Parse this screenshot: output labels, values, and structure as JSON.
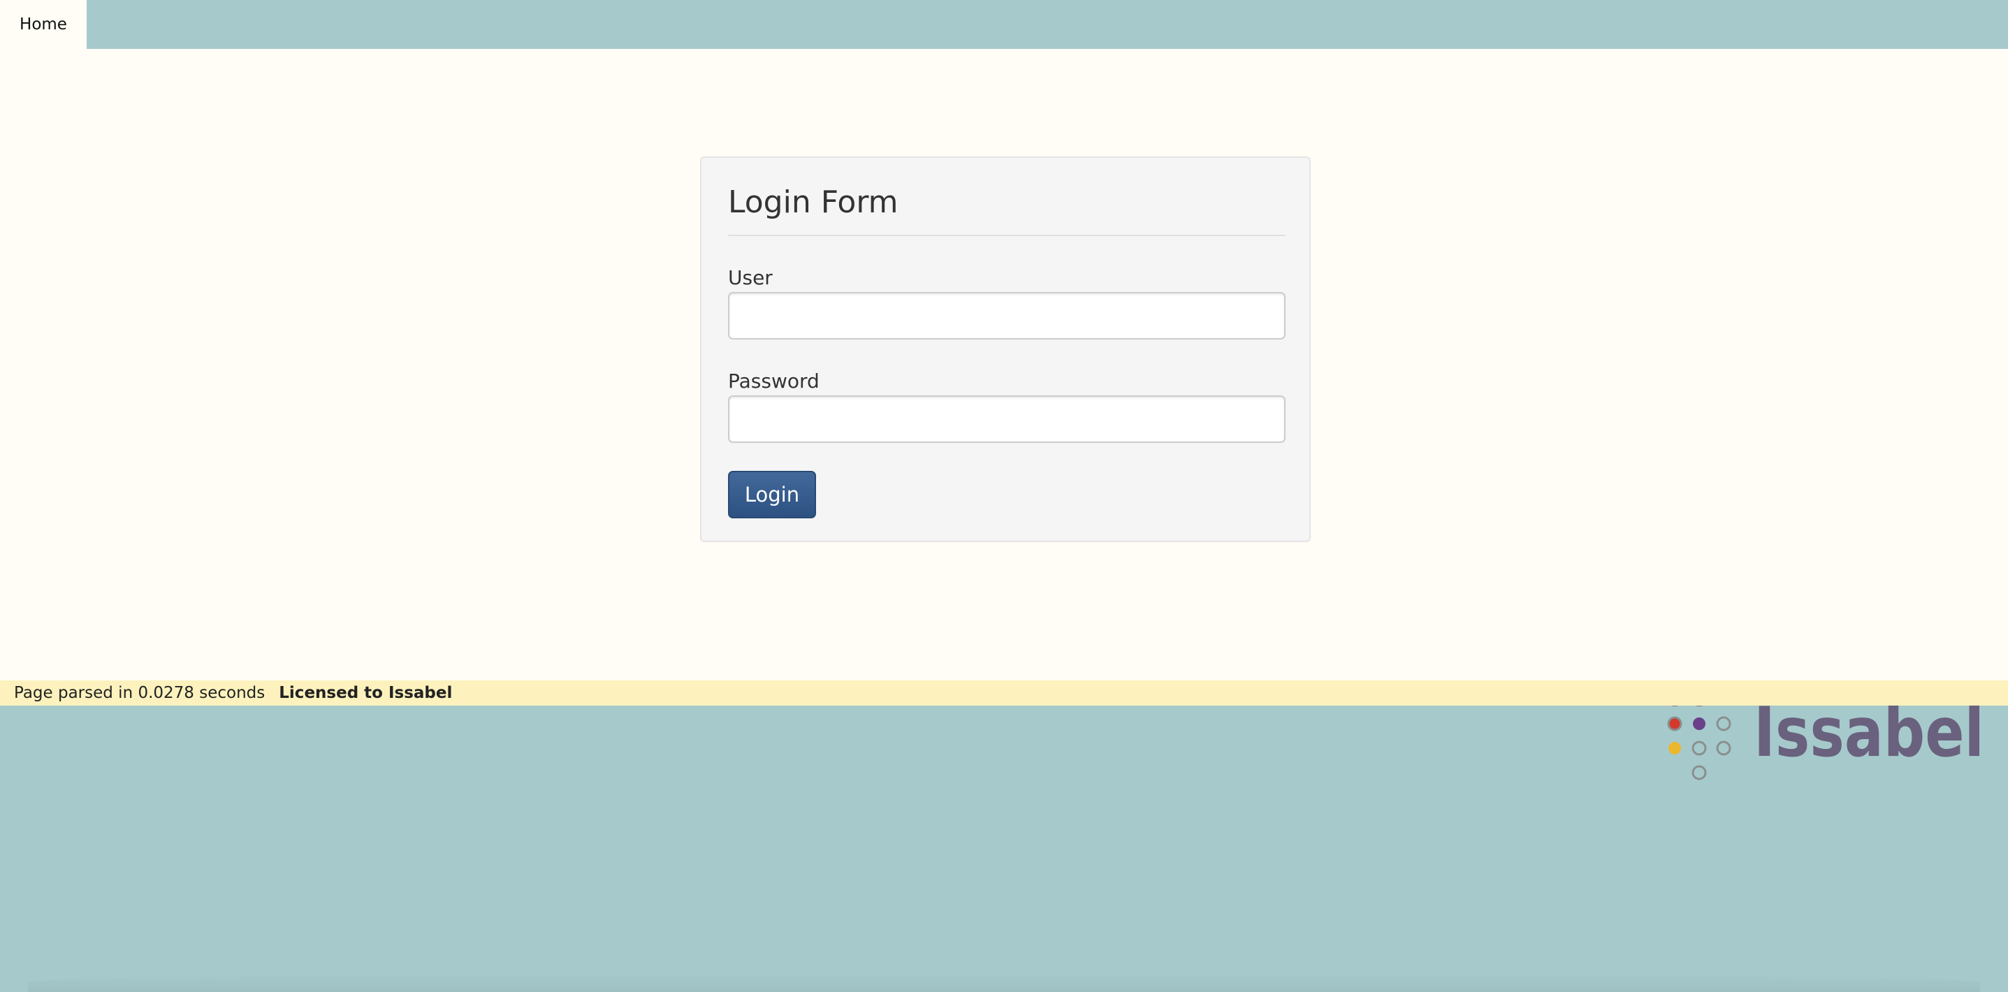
{
  "nav": {
    "home_label": "Home"
  },
  "login_form": {
    "title": "Login Form",
    "user_label": "User",
    "user_value": "",
    "password_label": "Password",
    "password_value": "",
    "submit_label": "Login"
  },
  "status_bar": {
    "parse_text": "Page parsed in 0.0278 seconds",
    "license_text": "Licensed to Issabel"
  },
  "logo": {
    "text": "Issabel",
    "text_color": "#6a617e",
    "dot_colors": {
      "teal": "#7ab5b9",
      "orange": "#e0762b",
      "red": "#d33a2c",
      "purple": "#6b3f8a",
      "yellow": "#eab72e",
      "outline": "#8a8f8f"
    }
  },
  "colors": {
    "top_bar": "#a6cacc",
    "page_background": "#fffdf5",
    "status_bar": "#fdf2bd",
    "button": "#345a8a"
  }
}
